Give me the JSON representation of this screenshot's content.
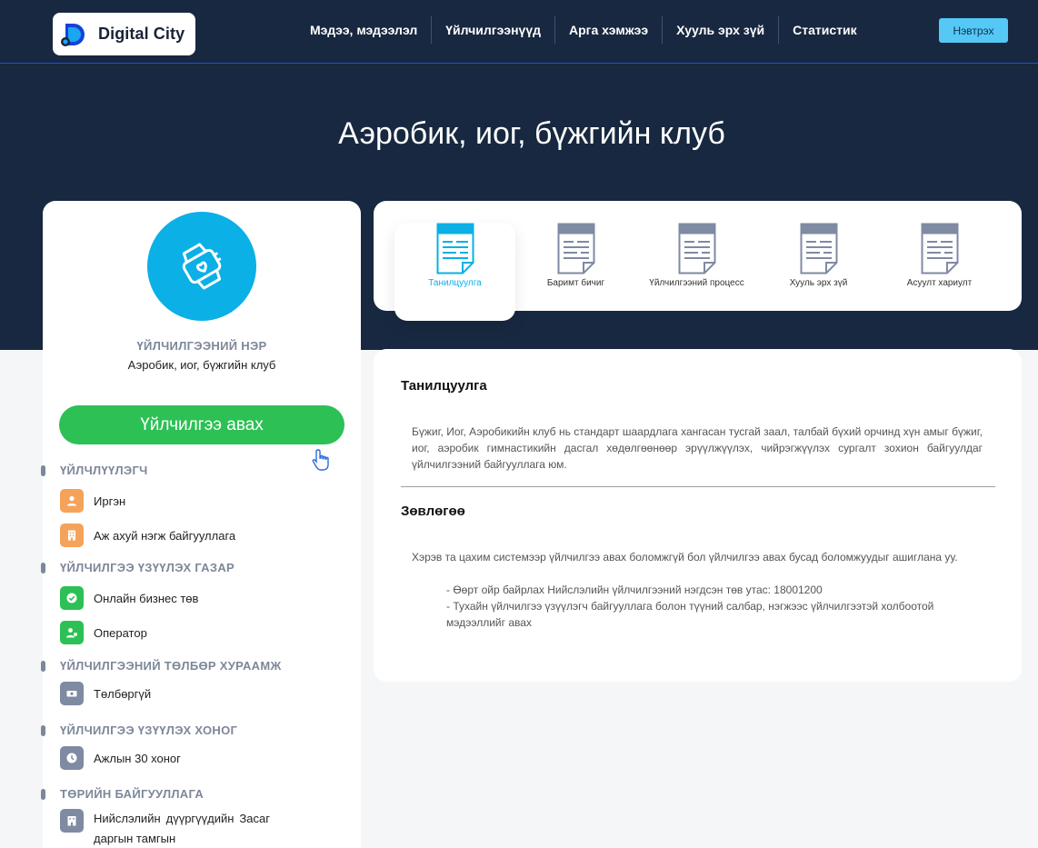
{
  "header": {
    "logo_text": "Digital City",
    "nav": [
      "Мэдээ, мэдээлэл",
      "Үйлчилгээнүүд",
      "Арга хэмжээ",
      "Хууль эрх зүй",
      "Статистик"
    ],
    "login_label": "Нэвтрэх"
  },
  "page_title": "Аэробик, иог, бүжгийн клуб",
  "left": {
    "name_label": "ҮЙЛЧИЛГЭЭНИЙ НЭР",
    "name_value": "Аэробик, иог, бүжгийн клуб",
    "get_button": "Үйлчилгээ авах",
    "sections": [
      {
        "title": "ҮЙЛЧЛҮҮЛЭГЧ",
        "items": [
          {
            "icon": "user-icon",
            "label": "Иргэн",
            "color": "#f5a35a"
          },
          {
            "icon": "building-icon",
            "label": "Аж ахуй нэгж байгууллага",
            "color": "#f5a35a"
          }
        ]
      },
      {
        "title": "ҮЙЛЧИЛГЭЭ ҮЗҮҮЛЭХ ГАЗАР",
        "items": [
          {
            "icon": "check-icon",
            "label": "Онлайн бизнес төв",
            "color": "#2dc055"
          },
          {
            "icon": "operator-icon",
            "label": "Оператор",
            "color": "#2dc055"
          }
        ]
      },
      {
        "title": "ҮЙЛЧИЛГЭЭНИЙ ТӨЛБӨР ХУРААМЖ",
        "items": [
          {
            "icon": "money-icon",
            "label": "Төлбөргүй",
            "color": "#7f8aa3"
          }
        ]
      },
      {
        "title": "ҮЙЛЧИЛГЭЭ ҮЗҮҮЛЭХ ХОНОГ",
        "items": [
          {
            "icon": "clock-icon",
            "label": "Ажлын 30 хоног",
            "color": "#7f8aa3"
          }
        ]
      },
      {
        "title": "ТӨРИЙН БАЙГУУЛЛАГА",
        "items": [
          {
            "icon": "office-icon",
            "label": "Нийслэлийн дүүргүүдийн Засаг даргын тамгын",
            "color": "#7f8aa3"
          }
        ]
      }
    ]
  },
  "tabs": [
    {
      "label": "Танилцуулга",
      "active": true
    },
    {
      "label": "Баримт бичиг",
      "active": false
    },
    {
      "label": "Үйлчилгээний процесс",
      "active": false
    },
    {
      "label": "Хууль эрх зүй",
      "active": false
    },
    {
      "label": "Асуулт хариулт",
      "active": false
    }
  ],
  "content": {
    "intro_heading": "Танилцуулга",
    "intro_text": "Бүжиг, Иог, Аэробикийн клуб нь стандарт шаардлага хангасан тусгай заал, талбай бүхий орчинд хүн амыг бүжиг, иог, аэробик гимнастикийн дасгал хөдөлгөөнөөр эрүүлжүүлэх, чийрэгжүүлэх сургалт зохион байгуулдаг үйлчилгээний байгууллага юм.",
    "advice_heading": "Зөвлөгөө",
    "advice_text": "Хэрэв та цахим системээр үйлчилгээ авах боломжгүй бол үйлчилгээ авах бусад боломжуудыг ашиглана уу.",
    "advice_items": [
      "- Өөрт ойр байрлах Нийслэлийн үйлчилгээний нэгдсэн төв утас: 18001200",
      "- Тухайн үйлчилгээ үзүүлэгч байгууллага болон түүний салбар, нэгжээс үйлчилгээтэй холбоотой мэдээллийг авах"
    ]
  },
  "colors": {
    "navy": "#172840",
    "accent_blue": "#0ab0e6",
    "green": "#2dc055",
    "orange": "#f5a35a",
    "grey": "#7f8aa3",
    "login": "#55c8f5"
  }
}
